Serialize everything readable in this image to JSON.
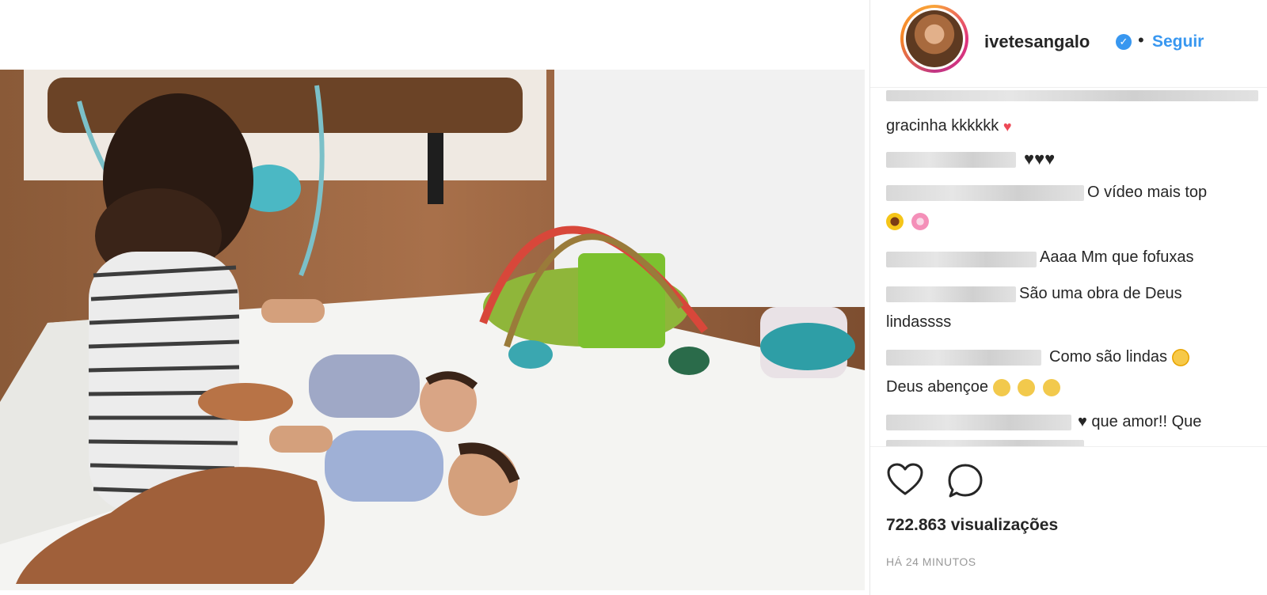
{
  "post": {
    "username": "ivetesangalo",
    "verified_icon": "verified-badge-icon",
    "separator": "•",
    "follow_label": "Seguir"
  },
  "comments": [
    {
      "text": "gracinha kkkkkk",
      "emoji": "heart-red"
    },
    {
      "text": "♥♥♥"
    },
    {
      "text": "O vídeo mais top"
    },
    {
      "emojis": [
        "sunflower",
        "cherry-blossom"
      ]
    },
    {
      "text": "Aaaa Mm que fofuxas"
    },
    {
      "text": "São uma obra de Deus"
    },
    {
      "text": "lindassss"
    },
    {
      "text": "Como são lindas"
    },
    {
      "text": "Deus abençoe"
    },
    {
      "text": "♥ que amor!! Que"
    }
  ],
  "actions": {
    "like_icon": "heart-icon",
    "comment_icon": "comment-bubble-icon"
  },
  "stats": {
    "views": "722.863 visualizações",
    "time": "HÁ 24 MINUTOS"
  },
  "colors": {
    "accent": "#3897f0",
    "text": "#262626",
    "muted": "#999999",
    "ring": "#e0337b"
  }
}
